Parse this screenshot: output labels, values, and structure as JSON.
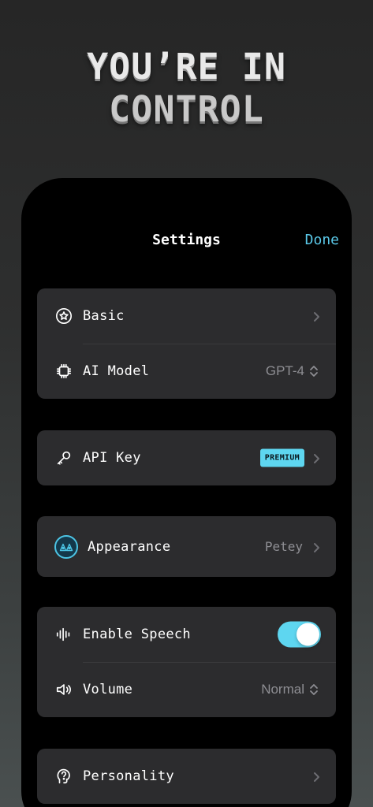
{
  "hero": {
    "line1": "YOU’RE IN",
    "line2": "CONTROL"
  },
  "nav": {
    "title": "Settings",
    "done_label": "Done"
  },
  "groups": {
    "general": {
      "basic": {
        "label": "Basic",
        "icon": "star-circle-icon"
      },
      "ai_model": {
        "label": "AI Model",
        "value": "GPT-4",
        "icon": "chip-icon"
      }
    },
    "api": {
      "api_key": {
        "label": "API Key",
        "badge": "PREMIUM",
        "icon": "key-icon"
      }
    },
    "appearance": {
      "label": "Appearance",
      "value": "Petey",
      "icon": "avatar-icon"
    },
    "audio": {
      "speech": {
        "label": "Enable Speech",
        "enabled": true,
        "icon": "waveform-icon"
      },
      "volume": {
        "label": "Volume",
        "value": "Normal",
        "icon": "speaker-icon"
      }
    },
    "personality": {
      "label": "Personality",
      "icon": "head-question-icon"
    }
  },
  "colors": {
    "accent": "#5ed6f0",
    "done": "#5ac8e8",
    "cell": "#2c2c2e",
    "secondary_text": "#8e8e93"
  }
}
